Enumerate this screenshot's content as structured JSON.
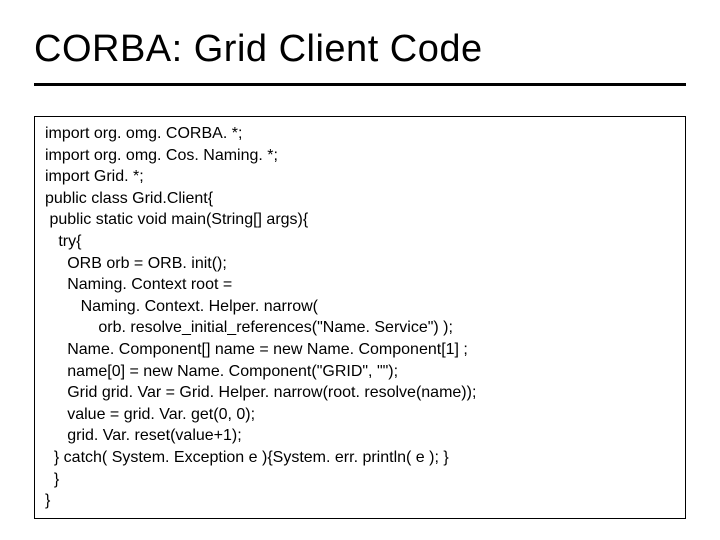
{
  "title": "CORBA: Grid Client Code",
  "code_lines": [
    "import org. omg. CORBA. *;",
    "import org. omg. Cos. Naming. *;",
    "import Grid. *;",
    "public class Grid.Client{",
    " public static void main(String[] args){",
    "   try{",
    "     ORB orb = ORB. init();",
    "     Naming. Context root =",
    "        Naming. Context. Helper. narrow(",
    "            orb. resolve_initial_references(\"Name. Service\") );",
    "     Name. Component[] name = new Name. Component[1] ;",
    "     name[0] = new Name. Component(\"GRID\", \"\");",
    "     Grid grid. Var = Grid. Helper. narrow(root. resolve(name));",
    "     value = grid. Var. get(0, 0);",
    "     grid. Var. reset(value+1);",
    "  } catch( System. Exception e ){System. err. println( e ); }",
    "  }",
    "}"
  ]
}
